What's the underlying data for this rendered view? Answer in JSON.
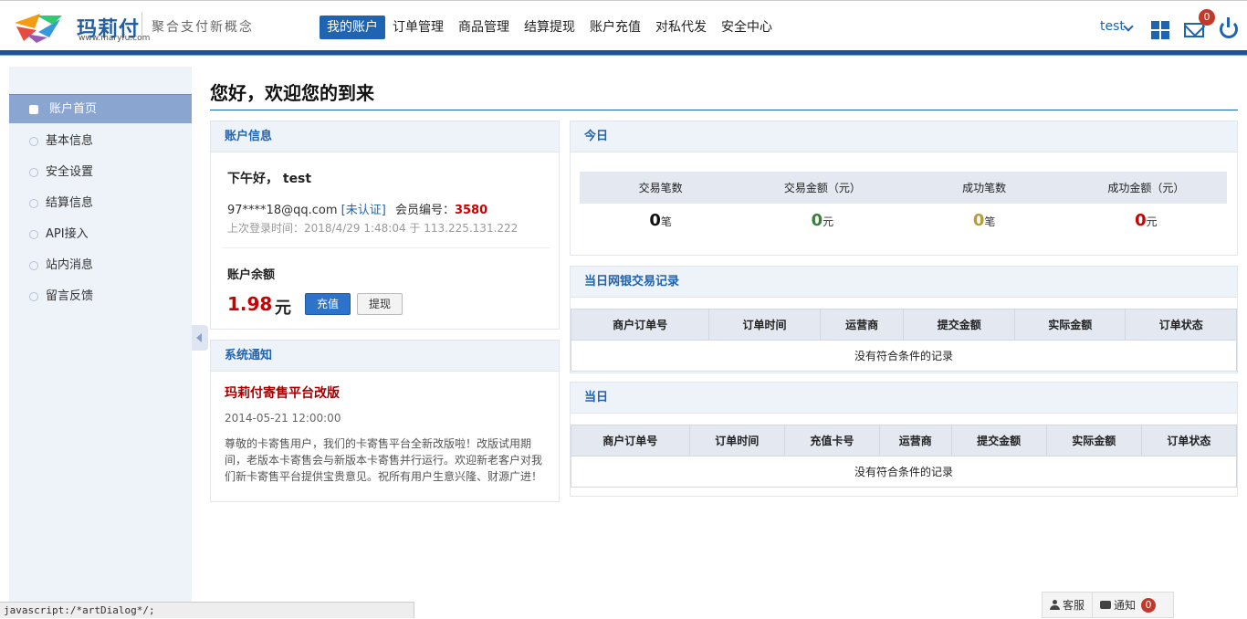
{
  "header": {
    "logo_text": "玛莉付",
    "logo_url": "www.maryfu.com",
    "slogan": "聚合支付新概念",
    "nav": [
      {
        "label": "我的账户",
        "active": true
      },
      {
        "label": "订单管理",
        "active": false
      },
      {
        "label": "商品管理",
        "active": false
      },
      {
        "label": "结算提现",
        "active": false
      },
      {
        "label": "账户充值",
        "active": false
      },
      {
        "label": "对私代发",
        "active": false
      },
      {
        "label": "安全中心",
        "active": false
      }
    ],
    "username": "test",
    "mail_count": "0"
  },
  "sidebar": {
    "items": [
      {
        "label": "账户首页",
        "active": true
      },
      {
        "label": "基本信息",
        "active": false
      },
      {
        "label": "安全设置",
        "active": false
      },
      {
        "label": "结算信息",
        "active": false
      },
      {
        "label": "API接入",
        "active": false
      },
      {
        "label": "站内消息",
        "active": false
      },
      {
        "label": "留言反馈",
        "active": false
      }
    ]
  },
  "main": {
    "title": "您好，欢迎您的到来"
  },
  "account": {
    "heading": "账户信息",
    "greeting": "下午好，  test",
    "email": "97****18@qq.com",
    "verify_status": "[未认证]",
    "member_label": "会员编号：",
    "member_id": "3580",
    "last_login": "上次登录时间：2018/4/29 1:48:04    于 113.225.131.222",
    "balance_label": "账户余额",
    "balance_value": "1.98",
    "balance_unit": "元",
    "recharge_label": "充值",
    "withdraw_label": "提现"
  },
  "notice": {
    "heading": "系统通知",
    "title": "玛莉付寄售平台改版",
    "date": "2014-05-21 12:00:00",
    "body": "尊敬的卡寄售用户，我们的卡寄售平台全新改版啦！改版试用期间，老版本卡寄售会与新版本卡寄售并行运行。欢迎新老客户对我们新卡寄售平台提供宝贵意见。祝所有用户生意兴隆、财源广进！"
  },
  "today": {
    "heading": "今日",
    "columns": [
      "交易笔数",
      "交易金额（元）",
      "成功笔数",
      "成功金额（元）"
    ],
    "values": [
      {
        "num": "0",
        "unit": "笔",
        "color": "#111111"
      },
      {
        "num": "0",
        "unit": "元",
        "color": "#3b7d3b"
      },
      {
        "num": "0",
        "unit": "笔",
        "color": "#b89b3a"
      },
      {
        "num": "0",
        "unit": "元",
        "color": "#cc0000"
      }
    ]
  },
  "bank_records": {
    "heading": "当日网银交易记录",
    "columns": [
      "商户订单号",
      "订单时间",
      "运营商",
      "提交金额",
      "实际金额",
      "订单状态"
    ],
    "empty_text": "没有符合条件的记录"
  },
  "card_records": {
    "heading": "当日",
    "columns": [
      "商户订单号",
      "订单时间",
      "充值卡号",
      "运营商",
      "提交金额",
      "实际金额",
      "订单状态"
    ],
    "empty_text": "没有符合条件的记录"
  },
  "statusbar": {
    "text": "javascript:/*artDialog*/;"
  },
  "dock": {
    "service_label": "客服",
    "notify_label": "通知",
    "notify_count": "0"
  },
  "colors": {
    "brand_blue": "#1f64b1",
    "header_bar": "#1f4f94",
    "sidebar_bg": "#eef2f9",
    "sidebar_active": "#8aa5d0",
    "alert_red": "#c00000"
  }
}
